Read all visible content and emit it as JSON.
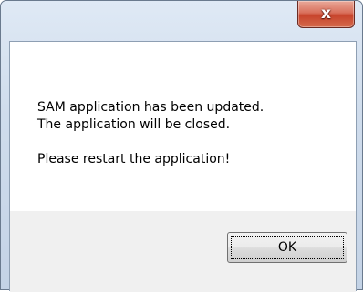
{
  "window": {
    "title": "",
    "close_glyph": "x",
    "close_icon": "close-icon"
  },
  "message": {
    "line1": "SAM application has been updated.",
    "line2": "The application will be closed.",
    "line3": "Please restart the application!"
  },
  "buttons": {
    "ok_label": "OK"
  },
  "colors": {
    "close_button": "#c7442c",
    "frame": "#cfdcec",
    "button_area": "#f0f0f0"
  }
}
